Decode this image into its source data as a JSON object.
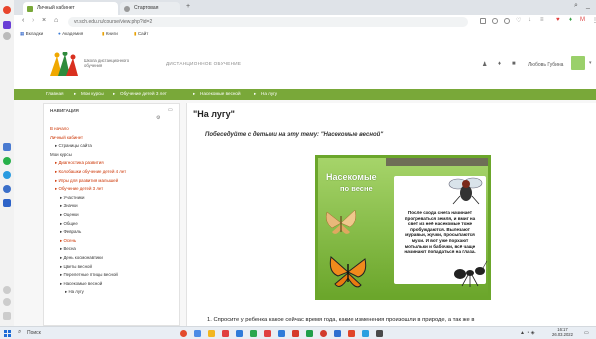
{
  "browser": {
    "tabs": [
      {
        "label": "Личный кабинет"
      },
      {
        "label": "Стартовая"
      }
    ],
    "new_tab_icon": "plus-icon",
    "url": "vr.sch.edu.ru/course/view.php?id=2",
    "bookmarks": [
      {
        "label": "Вкладки"
      },
      {
        "label": "Академия"
      },
      {
        "label": "Книги"
      },
      {
        "label": "Сайт"
      }
    ]
  },
  "site": {
    "logo_text": "Школа дистанционного обучения",
    "header_center": "ДИСТАНЦИОННОЕ ОБУЧЕНИЕ",
    "user_name": "Любовь Губина"
  },
  "breadcrumb": [
    {
      "label": "Главная"
    },
    {
      "label": "Мои курсы"
    },
    {
      "label": "Обучение детей 3 лет"
    },
    {
      "label": "Насекомые весной"
    },
    {
      "label": "На лугу"
    }
  ],
  "nav": {
    "title": "НАВИГАЦИЯ",
    "items": [
      {
        "label": "В начало",
        "indent": 0,
        "style": "link"
      },
      {
        "label": "Личный кабинет",
        "indent": 0,
        "style": "link"
      },
      {
        "label": "Страницы сайта",
        "indent": 1,
        "style": "dark"
      },
      {
        "label": "Мои курсы",
        "indent": 0,
        "style": "dark"
      },
      {
        "label": "Диагностика развития",
        "indent": 1,
        "style": "link"
      },
      {
        "label": "Колобашки обучение детей 4 лет",
        "indent": 1,
        "style": "link"
      },
      {
        "label": "Игры для развития малышей",
        "indent": 1,
        "style": "link"
      },
      {
        "label": "Обучение детей 3 лет",
        "indent": 1,
        "style": "link"
      },
      {
        "label": "Участники",
        "indent": 2,
        "style": "dark"
      },
      {
        "label": "Значки",
        "indent": 2,
        "style": "dark"
      },
      {
        "label": "Оценки",
        "indent": 2,
        "style": "dark"
      },
      {
        "label": "Общее",
        "indent": 2,
        "style": "dark"
      },
      {
        "label": "Февраль",
        "indent": 2,
        "style": "dark"
      },
      {
        "label": "Осень",
        "indent": 2,
        "style": "link"
      },
      {
        "label": "Весна",
        "indent": 2,
        "style": "dark"
      },
      {
        "label": "День космонавтики",
        "indent": 2,
        "style": "dark"
      },
      {
        "label": "Цветы весной",
        "indent": 2,
        "style": "dark"
      },
      {
        "label": "Перелетные птицы весной",
        "indent": 2,
        "style": "dark"
      },
      {
        "label": "Насекомые весной",
        "indent": 2,
        "style": "dark"
      },
      {
        "label": "На лугу",
        "indent": 3,
        "style": "dark"
      }
    ]
  },
  "main": {
    "title": "\"На лугу\"",
    "subtitle": "Побеседуйте с детьми на эту тему: \"Насекомые весной\"",
    "poster": {
      "title_line1": "Насекомые",
      "title_line2": "по весне",
      "body": "После схода снега начинает прогреваться земля, и вмиг на свет из неё насекомые тоже пробуждаются. Вылезают муравьи, жучки, просыпаются мухи. И вот уже порхают мотыльки и бабочки, всё чаще начинают попадаться на глаза."
    },
    "question": "1. Спросите у ребенка какое сейчас время года, какие изменения произошли в природе, а так же в"
  },
  "taskbar": {
    "search_placeholder": "Поиск",
    "time": "16:17",
    "date": "26.03.2022"
  },
  "colors": {
    "accent_green": "#79a839",
    "link_red": "#cc3300",
    "poster_green": "#6ba62b"
  }
}
